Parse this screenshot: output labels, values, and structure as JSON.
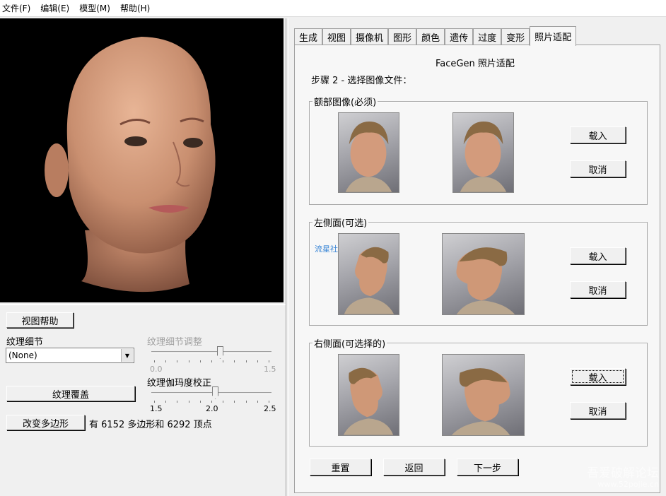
{
  "menu": [
    {
      "label": "文件(F)"
    },
    {
      "label": "编辑(E)"
    },
    {
      "label": "模型(M)"
    },
    {
      "label": "帮助(H)"
    }
  ],
  "left": {
    "view_help": "视图帮助",
    "texture_detail_label": "纹理细节",
    "texture_detail_value": "(None)",
    "detail_adjust_label": "纹理细节调整",
    "detail_adjust_min": "0.0",
    "detail_adjust_max": "1.5",
    "detail_adjust_value": 0.57,
    "texture_overlay": "纹理覆盖",
    "gamma_label": "纹理伽玛度校正",
    "gamma_min": "1.5",
    "gamma_mid": "2.0",
    "gamma_max": "2.5",
    "gamma_value": 0.53,
    "change_polygons": "改变多边形",
    "poly_info": "有 6152 多边形和 6292 顶点"
  },
  "tabs": [
    {
      "label": "生成",
      "active": false
    },
    {
      "label": "视图",
      "active": false
    },
    {
      "label": "摄像机",
      "active": false
    },
    {
      "label": "图形",
      "active": false
    },
    {
      "label": "颜色",
      "active": false
    },
    {
      "label": "遗传",
      "active": false
    },
    {
      "label": "过度",
      "active": false
    },
    {
      "label": "变形",
      "active": false
    },
    {
      "label": "照片适配",
      "active": true
    }
  ],
  "photofit": {
    "title": "FaceGen 照片适配",
    "step": "步骤 2 - 选择图像文件：",
    "frontal": {
      "title": "额部图像(必须)",
      "load": "载入",
      "cancel": "取消"
    },
    "left_side": {
      "title": "左侧面(可选)",
      "load": "载入",
      "cancel": "取消",
      "overlay_text": "流星社"
    },
    "right_side": {
      "title": "右侧面(可选择的)",
      "load": "载入",
      "cancel": "取消"
    },
    "reset": "重置",
    "back": "返回",
    "next": "下一步"
  },
  "watermark": {
    "line1": "吾爱破解论坛",
    "line2": "www.52pojie.cn"
  },
  "icons": {
    "dropdown": "chevron-down-icon"
  }
}
